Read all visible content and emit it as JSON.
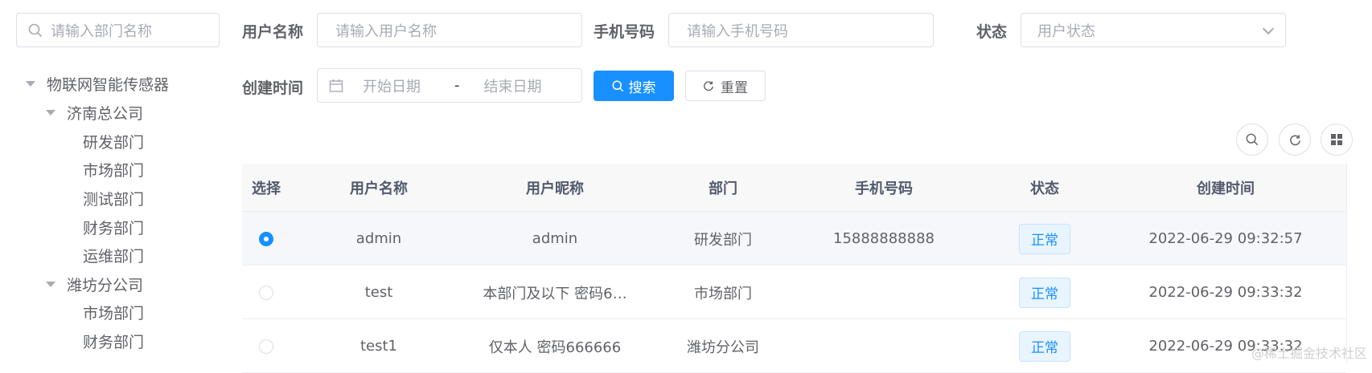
{
  "tree": {
    "search_placeholder": "请输入部门名称",
    "nodes": [
      {
        "label": "物联网智能传感器"
      },
      {
        "label": "济南总公司"
      },
      {
        "label": "研发部门"
      },
      {
        "label": "市场部门"
      },
      {
        "label": "测试部门"
      },
      {
        "label": "财务部门"
      },
      {
        "label": "运维部门"
      },
      {
        "label": "潍坊分公司"
      },
      {
        "label": "市场部门"
      },
      {
        "label": "财务部门"
      }
    ]
  },
  "form": {
    "username_label": "用户名称",
    "username_placeholder": "请输入用户名称",
    "phone_label": "手机号码",
    "phone_placeholder": "请输入手机号码",
    "status_label": "状态",
    "status_placeholder": "用户状态",
    "created_label": "创建时间",
    "start_placeholder": "开始日期",
    "range_separator": "-",
    "end_placeholder": "结束日期",
    "search_button": "搜索",
    "reset_button": "重置"
  },
  "table": {
    "headers": [
      "选择",
      "用户名称",
      "用户昵称",
      "部门",
      "手机号码",
      "状态",
      "创建时间"
    ],
    "rows": [
      {
        "selected": true,
        "username": "admin",
        "nickname": "admin",
        "dept": "研发部门",
        "phone": "15888888888",
        "status": "正常",
        "created": "2022-06-29 09:32:57"
      },
      {
        "selected": false,
        "username": "test",
        "nickname": "本部门及以下 密码6…",
        "dept": "市场部门",
        "phone": "",
        "status": "正常",
        "created": "2022-06-29 09:33:32"
      },
      {
        "selected": false,
        "username": "test1",
        "nickname": "仅本人 密码666666",
        "dept": "潍坊分公司",
        "phone": "",
        "status": "正常",
        "created": "2022-06-29 09:33:32"
      }
    ]
  },
  "watermark": "@稀土掘金技术社区",
  "colors": {
    "primary": "#1890ff",
    "border": "#dcdfe6",
    "header_bg": "#f8f8f9"
  }
}
